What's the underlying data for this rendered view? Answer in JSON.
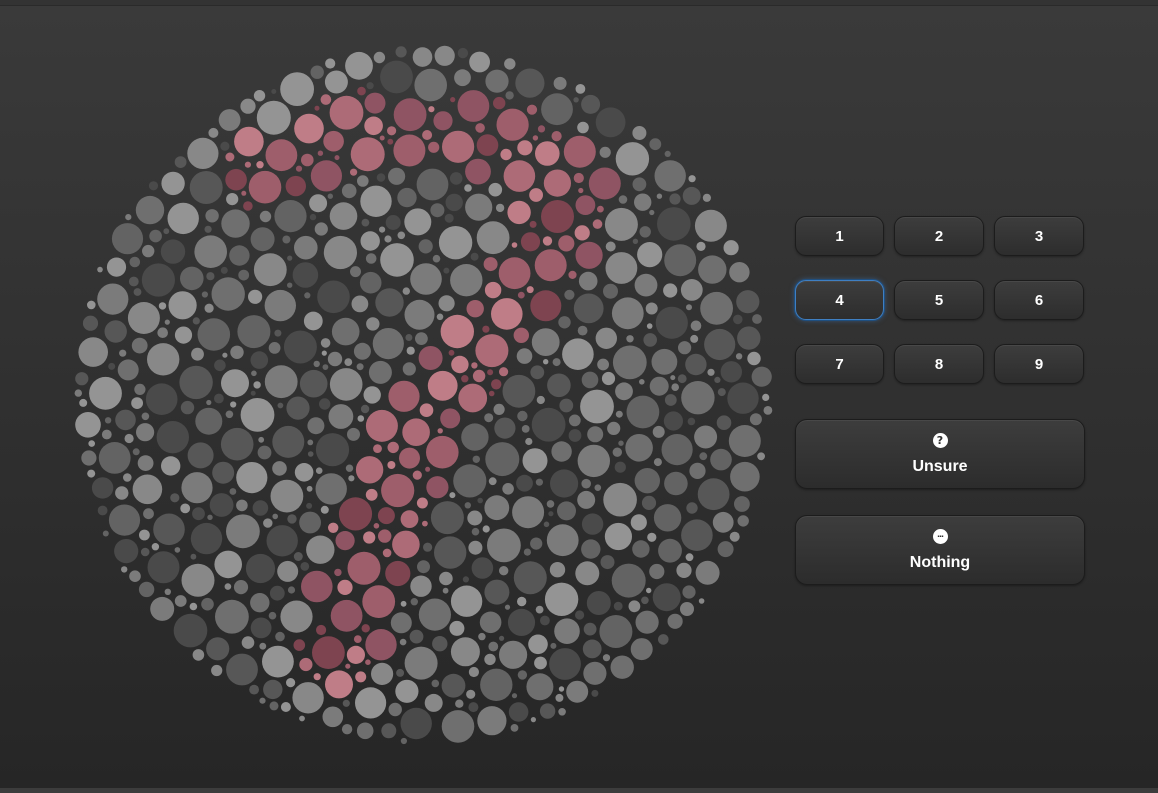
{
  "plate": {
    "colors": {
      "background_dots": [
        "#4a4a4a",
        "#575757",
        "#636363",
        "#6f6f6f",
        "#7b7b7b",
        "#888888",
        "#949494"
      ],
      "figure_dots": [
        "#7e4450",
        "#8f5463",
        "#9e5e6b",
        "#ad6b77",
        "#bf7d87"
      ]
    }
  },
  "answers": {
    "numbers": [
      {
        "label": "1"
      },
      {
        "label": "2"
      },
      {
        "label": "3"
      },
      {
        "label": "4",
        "selected": true
      },
      {
        "label": "5"
      },
      {
        "label": "6"
      },
      {
        "label": "7"
      },
      {
        "label": "8"
      },
      {
        "label": "9"
      }
    ],
    "unsure": {
      "label": "Unsure",
      "icon": "question-circle-icon",
      "glyph": "?"
    },
    "nothing": {
      "label": "Nothing",
      "icon": "ellipsis-circle-icon",
      "glyph": "···"
    }
  },
  "theme": {
    "accent_selected": "#3f7fc2"
  }
}
